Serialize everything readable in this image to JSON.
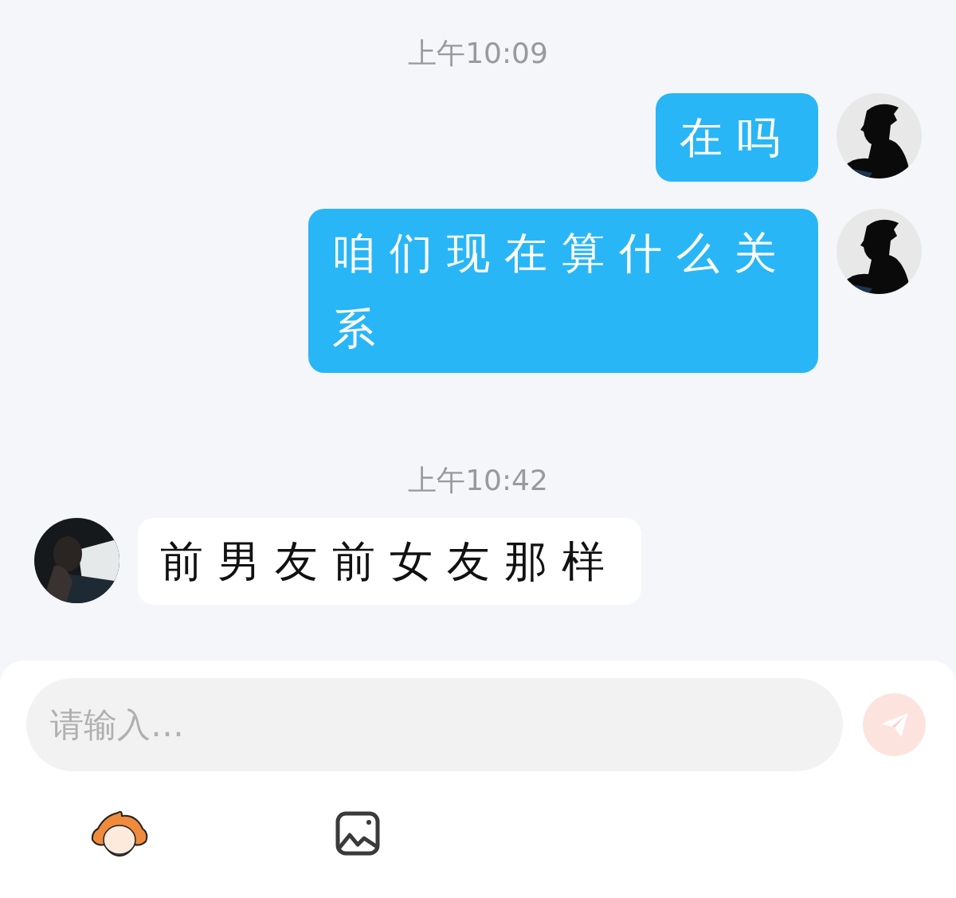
{
  "messages": [
    {
      "kind": "time",
      "text": "上午10:09"
    },
    {
      "kind": "sent",
      "text": "在吗"
    },
    {
      "kind": "sent",
      "text": "咱们现在算什么关系"
    },
    {
      "kind": "time",
      "text": "上午10:42"
    },
    {
      "kind": "received",
      "text": "前男友前女友那样"
    }
  ],
  "composer": {
    "placeholder": "请输入…"
  }
}
